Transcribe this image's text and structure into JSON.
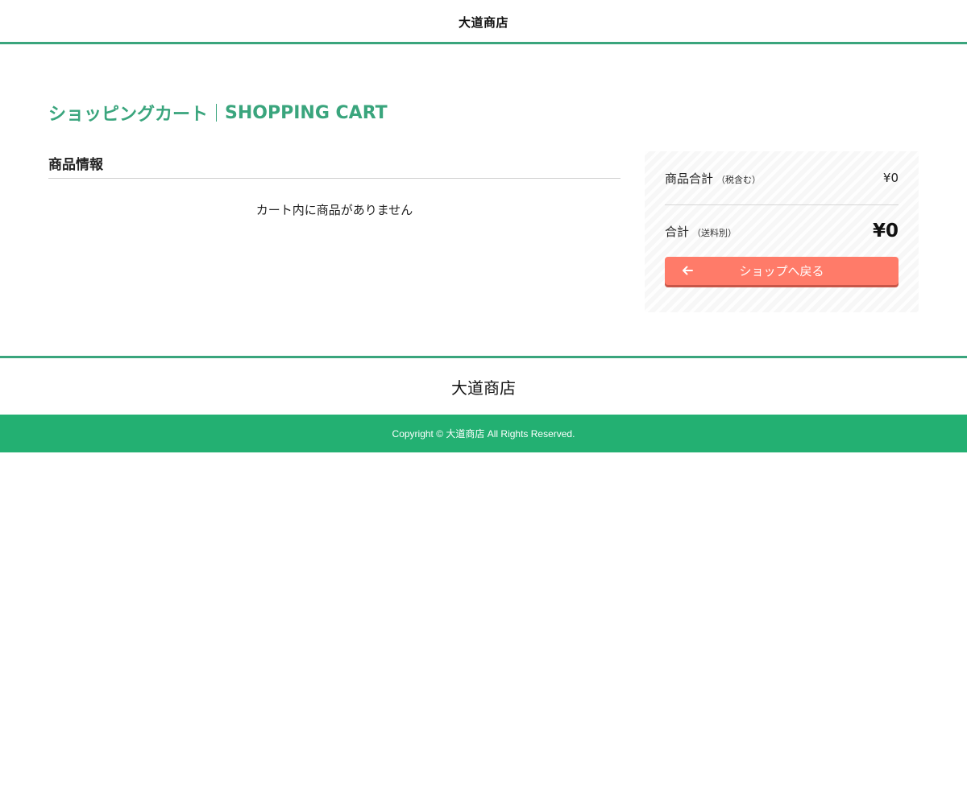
{
  "header": {
    "logo": "大道商店"
  },
  "page": {
    "title_ja": "ショッピングカート",
    "title_en": "SHOPPING CART"
  },
  "product_info": {
    "heading": "商品情報",
    "empty_message": "カート内に商品がありません"
  },
  "summary": {
    "subtotal_label": "商品合計",
    "subtotal_note": "（税含む）",
    "subtotal_value": "¥0",
    "total_label": "合計",
    "total_note": "（送料別）",
    "total_value": "¥0",
    "back_button_label": "ショップへ戻る",
    "back_button_icon": "arrow-left-icon"
  },
  "footer": {
    "logo": "大道商店",
    "copyright": "Copyright © 大道商店 All Rights Reserved."
  },
  "colors": {
    "accent": "#3aa57d",
    "footer_bar": "#23b072",
    "button": "#ff7b69",
    "button_shadow": "#c85648"
  }
}
